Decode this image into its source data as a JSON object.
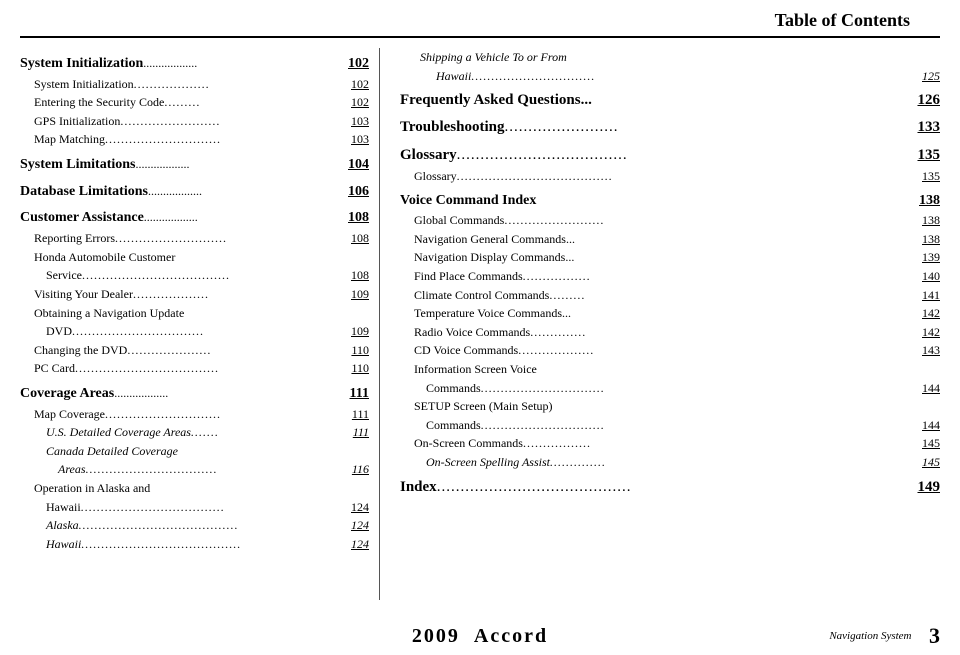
{
  "header": {
    "title": "Table of Contents"
  },
  "left_column": {
    "sections": [
      {
        "id": "system-init",
        "title": "System Initialization",
        "page": "102",
        "entries": [
          {
            "text": "System Initialization",
            "dots": "...................",
            "page": "102",
            "indent": 1
          },
          {
            "text": "Entering the Security Code",
            "dots": ".........",
            "page": "102",
            "indent": 1
          },
          {
            "text": "GPS Initialization",
            "dots": ".........................",
            "page": "103",
            "indent": 1
          },
          {
            "text": "Map Matching",
            "dots": ".............................",
            "page": "103",
            "indent": 1
          }
        ]
      },
      {
        "id": "system-limitations",
        "title": "System Limitations",
        "page": "104",
        "entries": []
      },
      {
        "id": "database-limitations",
        "title": "Database Limitations",
        "page": "106",
        "entries": []
      },
      {
        "id": "customer-assistance",
        "title": "Customer Assistance",
        "page": "108",
        "entries": [
          {
            "text": "Reporting Errors",
            "dots": "............................",
            "page": "108",
            "indent": 1
          },
          {
            "text": "Honda Automobile Customer",
            "dots": "",
            "page": "",
            "indent": 1
          },
          {
            "text": "Service",
            "dots": ".....................................",
            "page": "108",
            "indent": 2
          },
          {
            "text": "Visiting Your Dealer",
            "dots": "...................",
            "page": "109",
            "indent": 1
          },
          {
            "text": "Obtaining a Navigation Update",
            "dots": "",
            "page": "",
            "indent": 1
          },
          {
            "text": "DVD",
            "dots": ".................................",
            "page": "109",
            "indent": 2
          },
          {
            "text": "Changing the DVD",
            "dots": ".....................",
            "page": "110",
            "indent": 1
          },
          {
            "text": "PC Card",
            "dots": "....................................",
            "page": "110",
            "indent": 1
          }
        ]
      },
      {
        "id": "coverage-areas",
        "title": "Coverage Areas",
        "page": "111",
        "entries": [
          {
            "text": "Map Coverage",
            "dots": ".............................",
            "page": "111",
            "indent": 1
          },
          {
            "text": "U.S. Detailed Coverage Areas",
            "dots": ".......",
            "page": "111",
            "indent": 2,
            "italic": true
          },
          {
            "text": "Canada Detailed Coverage",
            "dots": "",
            "page": "",
            "indent": 2,
            "italic": true
          },
          {
            "text": "Areas",
            "dots": ".................................",
            "page": "116",
            "indent": 3,
            "italic": true
          },
          {
            "text": "Operation in Alaska and",
            "dots": "",
            "page": "",
            "indent": 1
          },
          {
            "text": "Hawaii",
            "dots": "....................................",
            "page": "124",
            "indent": 2
          },
          {
            "text": "Alaska",
            "dots": "........................................",
            "page": "124",
            "indent": 2,
            "italic": true
          },
          {
            "text": "Hawaii",
            "dots": "........................................",
            "page": "124",
            "indent": 2,
            "italic": true
          }
        ]
      }
    ]
  },
  "right_column": {
    "top_entry": {
      "text1": "Shipping a Vehicle To or From",
      "text2": "Hawaii",
      "dots": "...............................",
      "page": "125",
      "italic": true
    },
    "sections": [
      {
        "id": "faq",
        "title": "Frequently Asked Questions...",
        "page": "126",
        "entries": []
      },
      {
        "id": "troubleshooting",
        "title": "Troubleshooting",
        "page": "133",
        "entries": []
      },
      {
        "id": "glossary",
        "title": "Glossary",
        "page": "135",
        "entries": [
          {
            "text": "Glossary",
            "dots": ".......................................",
            "page": "135",
            "indent": 1
          }
        ]
      },
      {
        "id": "voice-command",
        "title": "Voice Command Index",
        "page": "138",
        "entries": [
          {
            "text": "Global Commands",
            "dots": ".........................",
            "page": "138",
            "indent": 1
          },
          {
            "text": "Navigation General Commands...",
            "dots": "",
            "page": "138",
            "indent": 1
          },
          {
            "text": "Navigation Display Commands...",
            "dots": "",
            "page": "139",
            "indent": 1
          },
          {
            "text": "Find Place Commands",
            "dots": ".................",
            "page": "140",
            "indent": 1
          },
          {
            "text": "Climate Control Commands",
            "dots": ".........",
            "page": "141",
            "indent": 1
          },
          {
            "text": "Temperature Voice Commands...",
            "dots": "",
            "page": "142",
            "indent": 1
          },
          {
            "text": "Radio Voice Commands",
            "dots": "..............",
            "page": "142",
            "indent": 1
          },
          {
            "text": "CD Voice Commands",
            "dots": "...................",
            "page": "143",
            "indent": 1
          },
          {
            "text": "Information Screen Voice",
            "dots": "",
            "page": "",
            "indent": 1
          },
          {
            "text": "Commands",
            "dots": "...............................",
            "page": "144",
            "indent": 2
          },
          {
            "text": "SETUP Screen (Main Setup)",
            "dots": "",
            "page": "",
            "indent": 1
          },
          {
            "text": "Commands",
            "dots": "...............................",
            "page": "144",
            "indent": 2
          },
          {
            "text": "On-Screen Commands",
            "dots": ".................",
            "page": "145",
            "indent": 1
          },
          {
            "text": "On-Screen Spelling Assist",
            "dots": "..............",
            "page": "145",
            "indent": 2,
            "italic": true
          }
        ]
      },
      {
        "id": "index",
        "title": "Index",
        "page": "149",
        "entries": []
      }
    ]
  },
  "footer": {
    "year": "2009",
    "model": "Accord",
    "nav_label": "Navigation System",
    "page_number": "3"
  }
}
